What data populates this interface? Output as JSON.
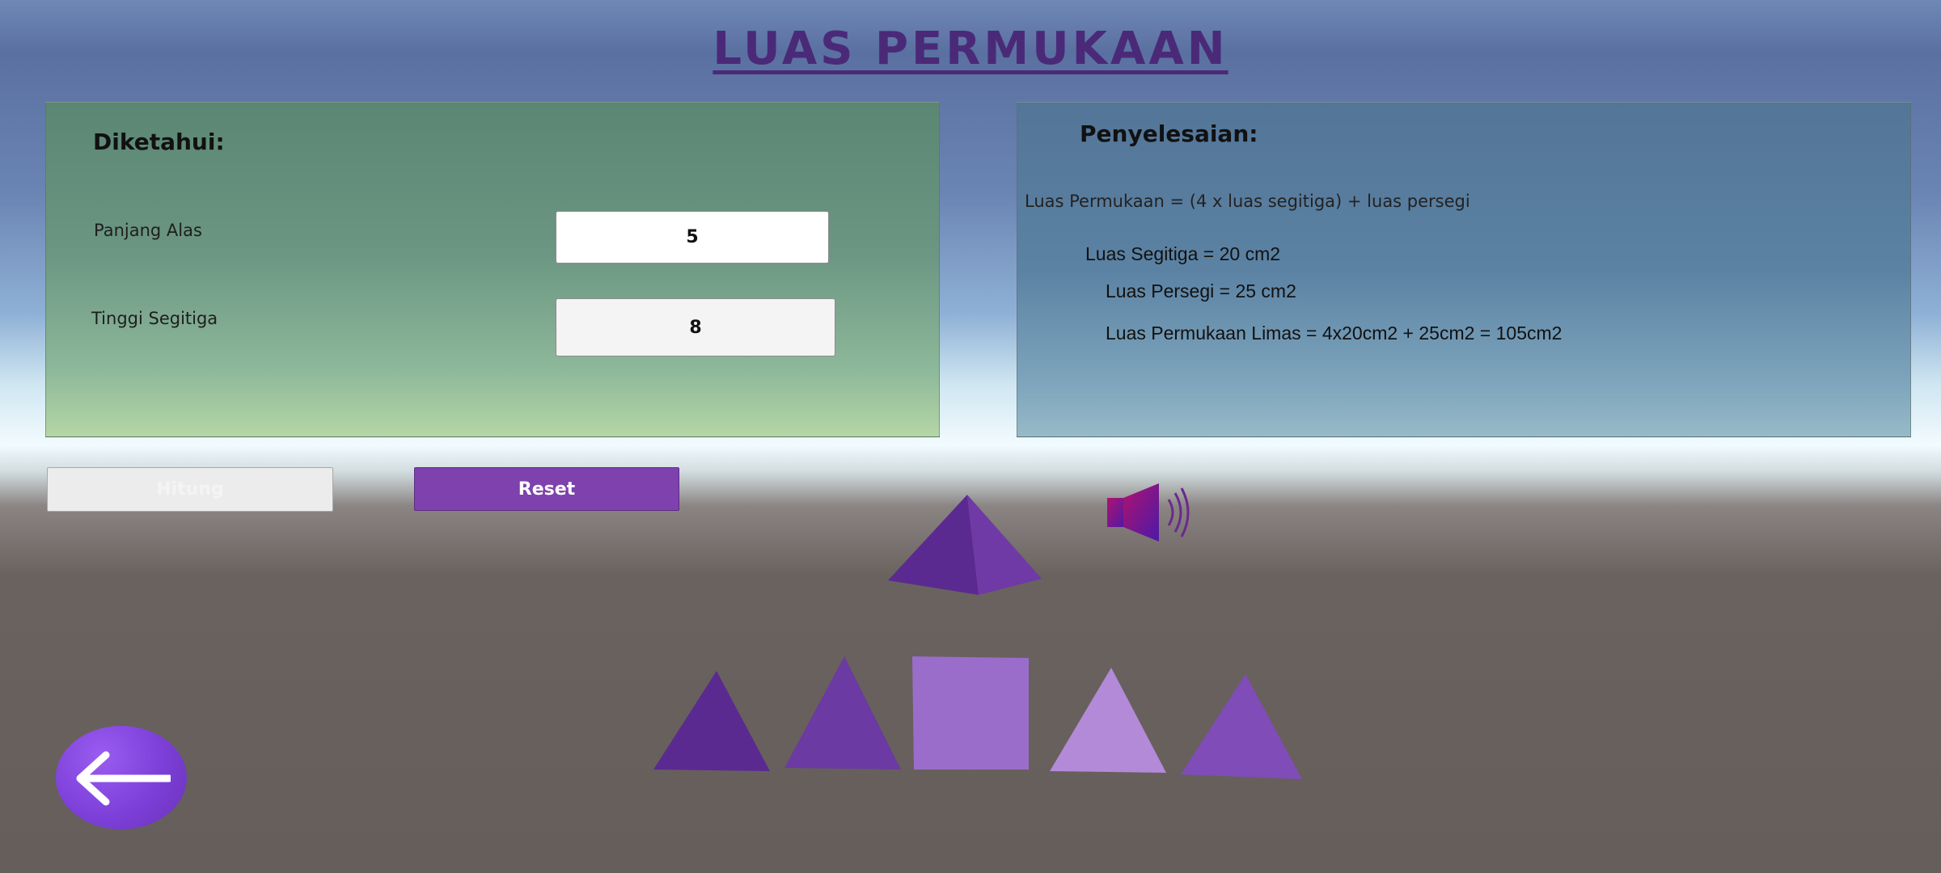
{
  "page": {
    "title": "LUAS PERMUKAAN"
  },
  "known": {
    "heading": "Diketahui:",
    "base_length_label": "Panjang Alas",
    "base_length_value": "5",
    "triangle_height_label": "Tinggi Segitiga",
    "triangle_height_value": "8"
  },
  "solution": {
    "heading": "Penyelesaian:",
    "formula": "Luas Permukaan = (4 x luas segitiga) + luas persegi",
    "triangle_area": "Luas Segitiga = 20 cm2",
    "square_area": "Luas Persegi = 25 cm2",
    "total_area": "Luas Permukaan Limas = 4x20cm2 + 25cm2 = 105cm2"
  },
  "buttons": {
    "hitung": "Hitung",
    "reset": "Reset"
  },
  "icons": {
    "sound": "speaker-icon",
    "back": "arrow-left-icon"
  },
  "colors": {
    "accent": "#7e41ad",
    "title": "#4a2a78"
  }
}
